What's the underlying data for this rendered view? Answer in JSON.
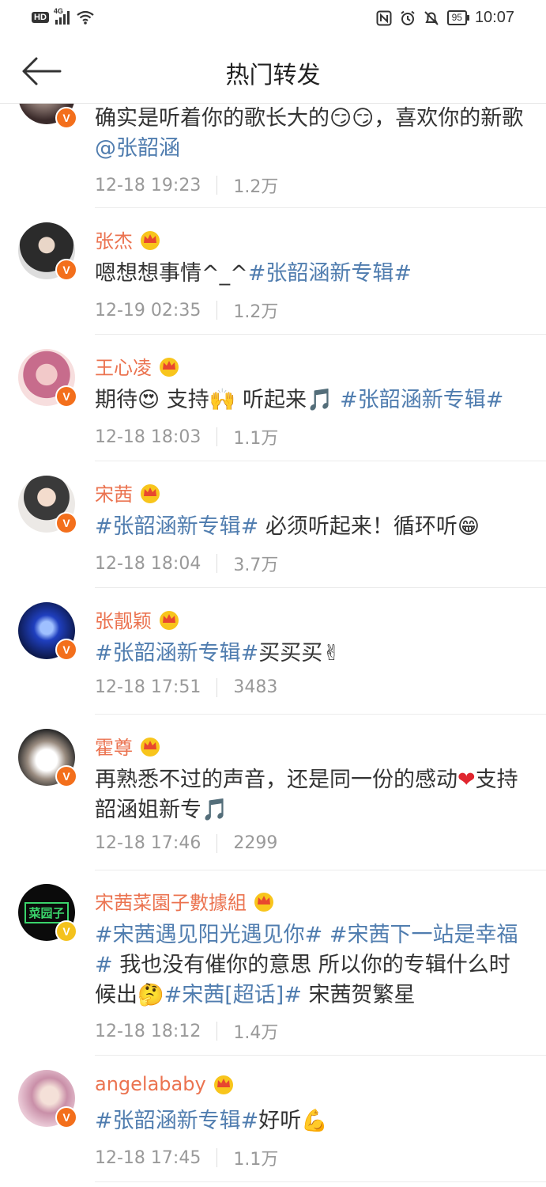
{
  "status_bar": {
    "hd": "HD",
    "network": "4G",
    "battery": "95",
    "time": "10:07"
  },
  "header": {
    "title": "热门转发"
  },
  "colors": {
    "username": "#eb7350",
    "topic": "#507daf",
    "verified": "#f36f1c"
  },
  "posts": [
    {
      "text_a": "确实是听着你的歌长大的",
      "emoji_1": "😏😏",
      "text_b": "，喜欢你的新歌",
      "mention": "@张韶涵",
      "time": "12-18 19:23",
      "count": "1.2万"
    },
    {
      "name": "张杰",
      "text_a": "嗯想想事情^_^",
      "topic": "#张韶涵新专辑#",
      "time": "12-19 02:35",
      "count": "1.2万"
    },
    {
      "name": "王心凌",
      "text_a": "期待",
      "emoji_1": "😍",
      "text_b": " 支持",
      "emoji_2": "🙌",
      "text_c": " 听起来",
      "emoji_3": "🎵",
      "topic": " #张韶涵新专辑#",
      "time": "12-18 18:03",
      "count": "1.1万"
    },
    {
      "name": "宋茜",
      "topic": "#张韶涵新专辑#",
      "text_a": " 必须听起来！循环听",
      "emoji_1": "😁",
      "time": "12-18 18:04",
      "count": "3.7万"
    },
    {
      "name": "张靓颖",
      "topic": "#张韶涵新专辑#",
      "text_a": "买买买",
      "emoji_1": "✌",
      "time": "12-18 17:51",
      "count": "3483"
    },
    {
      "name": "霍尊",
      "text_a": "再熟悉不过的声音，还是同一份的感动",
      "emoji_1": "❤",
      "text_b": "支持韶涵姐新专",
      "emoji_2": "🎵",
      "time": "12-18 17:46",
      "count": "2299"
    },
    {
      "name": "宋茜菜園子數據組",
      "avatar_text": "菜园子",
      "topic_1": "#宋茜遇见阳光遇见你#",
      "topic_2": " #宋茜下一站是幸福#",
      "text_a": " 我也没有催你的意思 所以你的专辑什么时候出",
      "emoji_1": "🤔",
      "topic_3": "#宋茜[超话]#",
      "text_b": " 宋茜贺繁星",
      "time": "12-18 18:12",
      "count": "1.4万"
    },
    {
      "name": "angelababy",
      "topic": "#张韶涵新专辑#",
      "text_a": "好听",
      "emoji_1": "💪",
      "time": "12-18 17:45",
      "count": "1.1万"
    }
  ]
}
